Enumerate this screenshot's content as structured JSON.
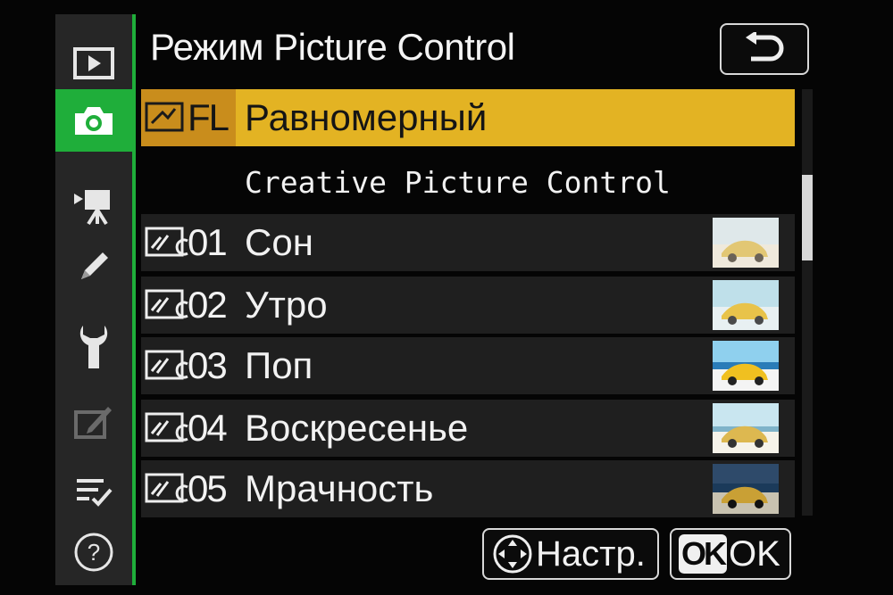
{
  "header": {
    "title": "Режим Picture Control"
  },
  "tabs": [
    {
      "name": "playback-icon"
    },
    {
      "name": "camera-icon",
      "active": true
    },
    {
      "name": "movie-camera-icon"
    },
    {
      "name": "pencil-icon"
    },
    {
      "name": "wrench-icon"
    },
    {
      "name": "retouch-icon"
    },
    {
      "name": "my-menu-icon"
    },
    {
      "name": "help-icon"
    }
  ],
  "list": {
    "selected": {
      "code": "FL",
      "label": "Равномерный"
    },
    "section_header": "Creative Picture Control",
    "items": [
      {
        "code": "01",
        "label": "Сон"
      },
      {
        "code": "02",
        "label": "Утро"
      },
      {
        "code": "03",
        "label": "Поп"
      },
      {
        "code": "04",
        "label": "Воскресенье"
      },
      {
        "code": "05",
        "label": "Мрачность"
      }
    ]
  },
  "footer": {
    "adjust_label": "Настр.",
    "ok_badge": "OK",
    "ok_label": "OK"
  },
  "colors": {
    "accent_green": "#1fae3a",
    "highlight_yellow": "#e3b323",
    "highlight_orange": "#c98d1c"
  }
}
